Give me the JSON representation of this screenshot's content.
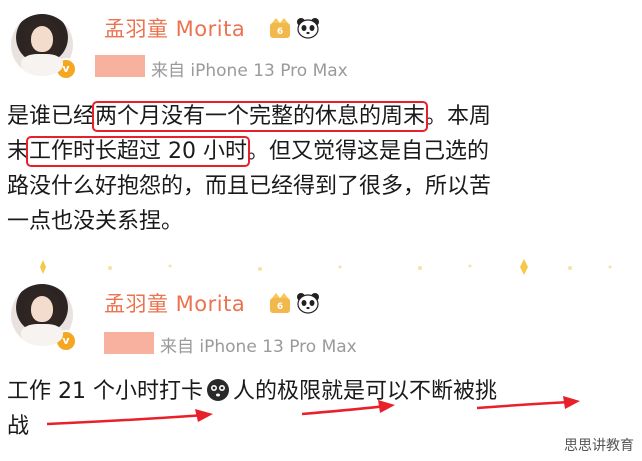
{
  "posts": [
    {
      "author": "孟羽童 Morita",
      "source": "来自 iPhone 13 Pro Max",
      "verified_badge": "v",
      "lines": [
        {
          "pre": "是谁已经",
          "hl": "两个月没有一个完整的休息的周末",
          "post": "。本周"
        },
        {
          "pre": "末",
          "hl": "工作时长超过 20 小时",
          "post": "。但又觉得这是自己选的"
        },
        {
          "pre": "路没什么好抱怨的，而且已经得到了很多，所以苦",
          "hl": "",
          "post": ""
        },
        {
          "pre": "一点也没关系捏。",
          "hl": "",
          "post": ""
        }
      ]
    },
    {
      "author": "孟羽童 Morita",
      "source": "来自 iPhone 13 Pro Max",
      "verified_badge": "v",
      "lines": [
        {
          "pre": "工作 21 个小时打卡",
          "post": "人的极限就是可以不断被挑"
        },
        {
          "pre": "战",
          "post": ""
        }
      ]
    }
  ],
  "watermark": "思思讲教育",
  "colors": {
    "name": "#eb7350",
    "highlight_box": "#e8202a",
    "arrow": "#e8202a",
    "redaction": "#f7b19e",
    "source_text": "#9a9a9a"
  },
  "icons": [
    "crown-icon",
    "panda-icon",
    "emoji-face-icon",
    "verified-badge-icon",
    "arrow-icon"
  ]
}
